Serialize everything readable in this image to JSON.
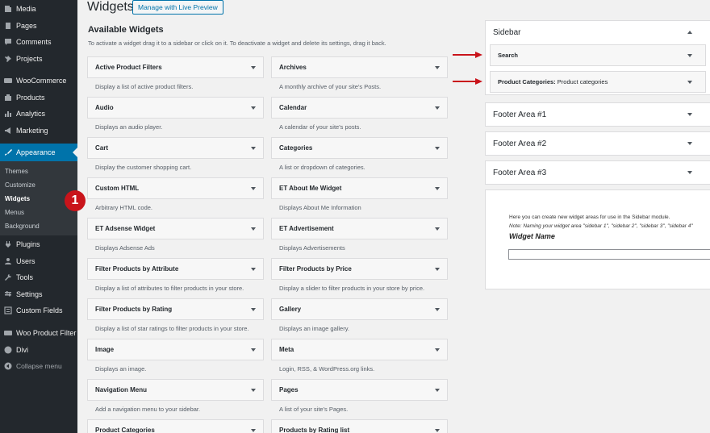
{
  "admin_menu": {
    "items": [
      {
        "label": "Media",
        "icon": "media-icon"
      },
      {
        "label": "Pages",
        "icon": "pages-icon"
      },
      {
        "label": "Comments",
        "icon": "comments-icon"
      },
      {
        "label": "Projects",
        "icon": "pin-icon"
      },
      {
        "label": "WooCommerce",
        "icon": "woocommerce-icon"
      },
      {
        "label": "Products",
        "icon": "products-icon"
      },
      {
        "label": "Analytics",
        "icon": "analytics-icon"
      },
      {
        "label": "Marketing",
        "icon": "megaphone-icon"
      },
      {
        "label": "Appearance",
        "icon": "paintbrush-icon"
      },
      {
        "label": "Plugins",
        "icon": "plugin-icon"
      },
      {
        "label": "Users",
        "icon": "users-icon"
      },
      {
        "label": "Tools",
        "icon": "tools-icon"
      },
      {
        "label": "Settings",
        "icon": "settings-icon"
      },
      {
        "label": "Custom Fields",
        "icon": "custom-fields-icon"
      },
      {
        "label": "Woo Product Filter",
        "icon": "filter-icon"
      },
      {
        "label": "Divi",
        "icon": "divi-icon"
      }
    ],
    "appearance_submenu": [
      "Themes",
      "Customize",
      "Widgets",
      "Menus",
      "Background"
    ],
    "collapse_label": "Collapse menu",
    "step_badge": "1"
  },
  "header": {
    "title": "Widgets",
    "live_preview_button": "Manage with Live Preview"
  },
  "available_widgets": {
    "title": "Available Widgets",
    "description": "To activate a widget drag it to a sidebar or click on it. To deactivate a widget and delete its settings, drag it back.",
    "left": [
      {
        "name": "Active Product Filters",
        "desc": "Display a list of active product filters."
      },
      {
        "name": "Audio",
        "desc": "Displays an audio player."
      },
      {
        "name": "Cart",
        "desc": "Display the customer shopping cart."
      },
      {
        "name": "Custom HTML",
        "desc": "Arbitrary HTML code."
      },
      {
        "name": "ET Adsense Widget",
        "desc": "Displays Adsense Ads"
      },
      {
        "name": "Filter Products by Attribute",
        "desc": "Display a list of attributes to filter products in your store."
      },
      {
        "name": "Filter Products by Rating",
        "desc": "Display a list of star ratings to filter products in your store."
      },
      {
        "name": "Image",
        "desc": "Displays an image."
      },
      {
        "name": "Navigation Menu",
        "desc": "Add a navigation menu to your sidebar."
      },
      {
        "name": "Product Categories",
        "desc": ""
      }
    ],
    "right": [
      {
        "name": "Archives",
        "desc": "A monthly archive of your site's Posts."
      },
      {
        "name": "Calendar",
        "desc": "A calendar of your site's posts."
      },
      {
        "name": "Categories",
        "desc": "A list or dropdown of categories."
      },
      {
        "name": "ET About Me Widget",
        "desc": "Displays About Me Information"
      },
      {
        "name": "ET Advertisement",
        "desc": "Displays Advertisements"
      },
      {
        "name": "Filter Products by Price",
        "desc": "Display a slider to filter products in your store by price."
      },
      {
        "name": "Gallery",
        "desc": "Displays an image gallery."
      },
      {
        "name": "Meta",
        "desc": "Login, RSS, & WordPress.org links."
      },
      {
        "name": "Pages",
        "desc": "A list of your site's Pages."
      },
      {
        "name": "Products by Rating list",
        "desc": ""
      }
    ]
  },
  "sidebars": {
    "sidebar": {
      "title": "Sidebar",
      "widgets": [
        {
          "name": "Search",
          "subtitle": ""
        },
        {
          "name": "Product Categories:",
          "subtitle": "Product categories"
        }
      ]
    },
    "footer_areas": [
      "Footer Area #1",
      "Footer Area #2",
      "Footer Area #3"
    ]
  },
  "create_widget_area": {
    "line1": "Here you can create new widget areas for use in the Sidebar module.",
    "line2": "Note: Naming your widget area \"sidebar 1\", \"sidebar 2\", \"sidebar 3\", \"sidebar 4\"",
    "label": "Widget Name",
    "input_value": ""
  }
}
